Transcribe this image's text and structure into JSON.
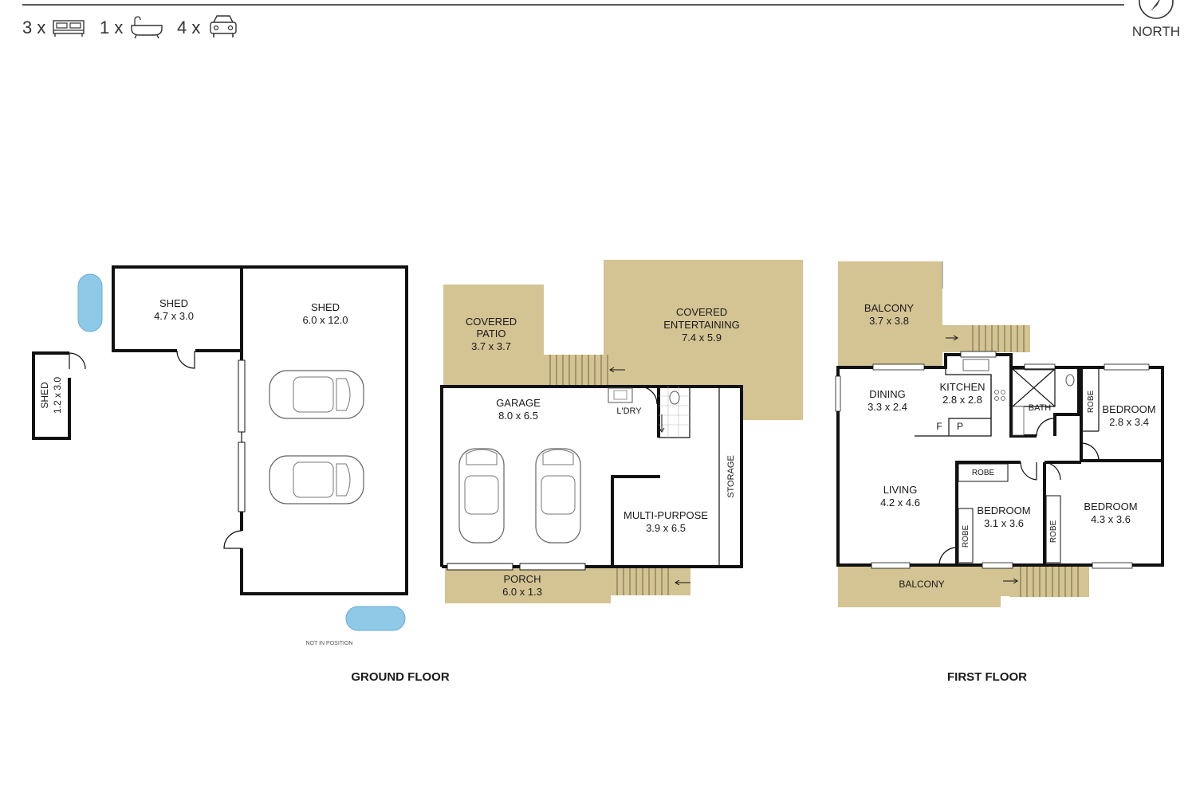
{
  "header": {
    "amenities": [
      {
        "count": "3",
        "suffix": "x",
        "icon": "bed-icon"
      },
      {
        "count": "1",
        "suffix": "x",
        "icon": "bath-icon"
      },
      {
        "count": "4",
        "suffix": "x",
        "icon": "car-icon"
      }
    ],
    "north_label": "NORTH"
  },
  "ground_floor": {
    "title": "GROUND FLOOR",
    "note": "NOT IN POSITION",
    "rooms": {
      "shed_small": {
        "name": "SHED",
        "size": "1.2 x 3.0"
      },
      "shed_mid": {
        "name": "SHED",
        "size": "4.7 x 3.0"
      },
      "shed_large": {
        "name": "SHED",
        "size": "6.0 x 12.0"
      },
      "covered_patio": {
        "name_line1": "COVERED",
        "name_line2": "PATIO",
        "size": "3.7 x 3.7"
      },
      "covered_entertaining": {
        "name_line1": "COVERED",
        "name_line2": "ENTERTAINING",
        "size": "7.4 x 5.9"
      },
      "garage": {
        "name": "GARAGE",
        "size": "8.0 x 6.5"
      },
      "laundry": {
        "name": "L'DRY"
      },
      "storage": {
        "name": "STORAGE"
      },
      "multi_purpose": {
        "name": "MULTI-PURPOSE",
        "size": "3.9 x 6.5"
      },
      "porch": {
        "name": "PORCH",
        "size": "6.0 x 1.3"
      }
    }
  },
  "first_floor": {
    "title": "FIRST FLOOR",
    "rooms": {
      "balcony_top": {
        "name": "BALCONY",
        "size": "3.7 x 3.8"
      },
      "dining": {
        "name": "DINING",
        "size": "3.3 x 2.4"
      },
      "kitchen": {
        "name": "KITCHEN",
        "size": "2.8 x 2.8"
      },
      "fridge": {
        "name": "F"
      },
      "pantry": {
        "name": "P"
      },
      "bath": {
        "name": "BATH"
      },
      "robe_bed1": {
        "name": "ROBE"
      },
      "bedroom1": {
        "name": "BEDROOM",
        "size": "2.8 x 3.4"
      },
      "living": {
        "name": "LIVING",
        "size": "4.2 x 4.6"
      },
      "robe_top": {
        "name": "ROBE"
      },
      "robe_bed2": {
        "name": "ROBE"
      },
      "bedroom2": {
        "name": "BEDROOM",
        "size": "3.1 x 3.6"
      },
      "robe_bed3": {
        "name": "ROBE"
      },
      "bedroom3": {
        "name": "BEDROOM",
        "size": "4.3 x 3.6"
      },
      "balcony_bottom": {
        "name": "BALCONY"
      }
    }
  }
}
